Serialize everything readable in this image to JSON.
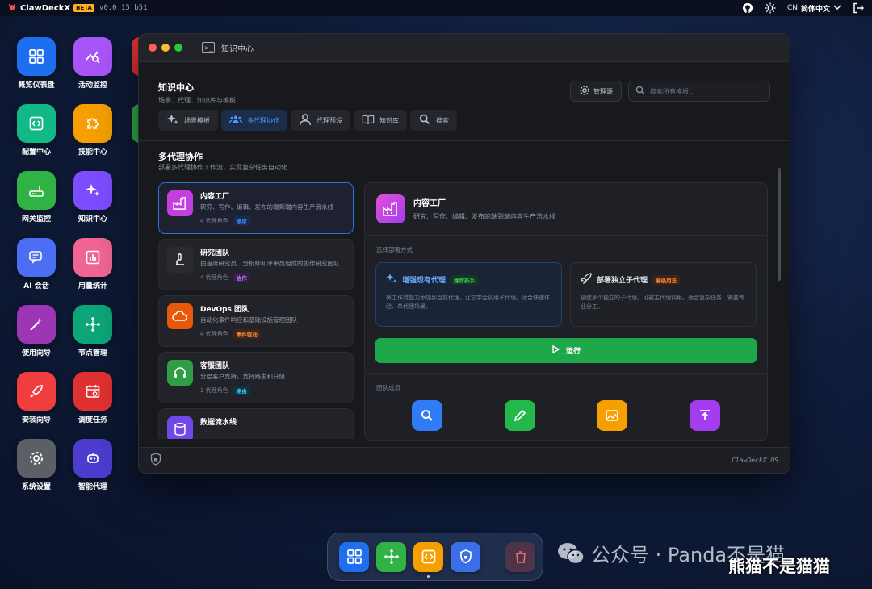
{
  "menubar": {
    "app_name": "ClawDeckX",
    "beta": "BETA",
    "version": "v0.0.15 b51",
    "lang_code": "CN",
    "lang_label": "简体中文"
  },
  "desktop_icons": [
    {
      "label": "概览仪表盘",
      "icon": "dashboard-icon",
      "color": "#1e6ff0"
    },
    {
      "label": "活动监控",
      "icon": "activity-icon",
      "color": "#a855f7"
    },
    {
      "label": "配置中心",
      "icon": "code-icon",
      "color": "#12b886"
    },
    {
      "label": "技能中心",
      "icon": "puzzle-icon",
      "color": "#f59f00"
    },
    {
      "label": "网关监控",
      "icon": "router-icon",
      "color": "#2fb344"
    },
    {
      "label": "知识中心",
      "icon": "sparkle-icon",
      "color": "#7c4dff"
    },
    {
      "label": "AI 会话",
      "icon": "chat-icon",
      "color": "#4c6ef5"
    },
    {
      "label": "用量统计",
      "icon": "chart-icon",
      "color": "#f06595"
    },
    {
      "label": "使用向导",
      "icon": "wand-icon",
      "color": "#9c36b5"
    },
    {
      "label": "节点管理",
      "icon": "nodes-icon",
      "color": "#0ca678"
    },
    {
      "label": "安装向导",
      "icon": "rocket-icon",
      "color": "#f03e3e"
    },
    {
      "label": "调度任务",
      "icon": "calendar-icon",
      "color": "#e03131"
    },
    {
      "label": "系统设置",
      "icon": "gear-icon",
      "color": "#5c5f66"
    },
    {
      "label": "智能代理",
      "icon": "robot-icon",
      "color": "#4c3cd0"
    }
  ],
  "window": {
    "title": "知识中心",
    "header_title": "知识中心",
    "header_subtitle": "场景、代理、知识库与模板",
    "manage_label": "管理源",
    "search_placeholder": "搜索所有模板...",
    "tabs": [
      {
        "label": "场景模板",
        "icon": "sparkle-icon"
      },
      {
        "label": "多代理协作",
        "icon": "users-icon",
        "active": true
      },
      {
        "label": "代理预设",
        "icon": "user-icon"
      },
      {
        "label": "知识库",
        "icon": "book-icon"
      },
      {
        "label": "搜索",
        "icon": "search-icon"
      }
    ],
    "section_title": "多代理协作",
    "section_subtitle": "部署多代理协作工作流，实现复杂任务自动化",
    "cards": [
      {
        "name": "内容工厂",
        "desc": "研究、写作、编辑、发布的端到端内容生产流水线",
        "roles": "4 代理角色",
        "badge": "顺序",
        "badge_color": "#3d8bff",
        "badge_bg": "#1a2c4d",
        "icon_bg": "#c43fe0",
        "icon": "factory-icon"
      },
      {
        "name": "研究团队",
        "desc": "由首席研究员、分析师和评审员组成的协作研究团队",
        "roles": "4 代理角色",
        "badge": "协作",
        "badge_color": "#c77dff",
        "badge_bg": "#33204a",
        "icon_bg": "#2a2b31",
        "icon": "microscope-icon"
      },
      {
        "name": "DevOps 团队",
        "desc": "自动化事件响应和基础设施管理团队",
        "roles": "4 代理角色",
        "badge": "事件驱动",
        "badge_color": "#ff8a3d",
        "badge_bg": "#3d2417",
        "icon_bg": "#e8590c",
        "icon": "cloud-icon"
      },
      {
        "name": "客服团队",
        "desc": "分层客户支持，支持路由和升级",
        "roles": "3 代理角色",
        "badge": "路由",
        "badge_color": "#33c3e8",
        "badge_bg": "#13323d",
        "icon_bg": "#2f9e44",
        "icon": "headset-icon"
      },
      {
        "name": "数据流水线",
        "desc": "",
        "roles": "",
        "badge": "",
        "badge_color": "#3d8bff",
        "badge_bg": "#1a2c4d",
        "icon_bg": "#7048e8",
        "icon": "data-icon"
      }
    ],
    "detail": {
      "name": "内容工厂",
      "desc": "研究、写作、编辑、发布的端到端内容生产流水线",
      "deploy_label": "选择部署方式",
      "mode1_title": "增强现有代理",
      "mode1_badge": "推荐新手",
      "mode1_desc": "将工作流能力添加到当前代理，让它学会调用子代理。适合快速体验、单代理场景。",
      "mode2_title": "部署独立子代理",
      "mode2_badge": "高级用法",
      "mode2_desc": "创建多个独立的子代理，可被主代理调用。适合复杂任务、需要专业分工。",
      "run_label": "运行",
      "members_label": "团队成员",
      "members": [
        {
          "icon": "search-icon",
          "color": "#2f7cf6"
        },
        {
          "icon": "pencil-icon",
          "color": "#22b84a"
        },
        {
          "icon": "image-icon",
          "color": "#f59f00"
        },
        {
          "icon": "upload-icon",
          "color": "#a43cf0"
        }
      ]
    },
    "os_label": "ClawDeckX OS"
  },
  "dock": [
    {
      "icon": "dashboard-icon",
      "color": "#1e6ff0"
    },
    {
      "icon": "nodes-icon",
      "color": "#2fb344"
    },
    {
      "icon": "code-icon",
      "color": "#f59f00"
    },
    {
      "icon": "shield-icon",
      "color": "#3b6fe8"
    },
    {
      "icon": "trash-icon",
      "color": ""
    }
  ],
  "watermark": {
    "line1": "公众号 · Panda不是猫",
    "line2": "熊猫不是猫猫"
  }
}
